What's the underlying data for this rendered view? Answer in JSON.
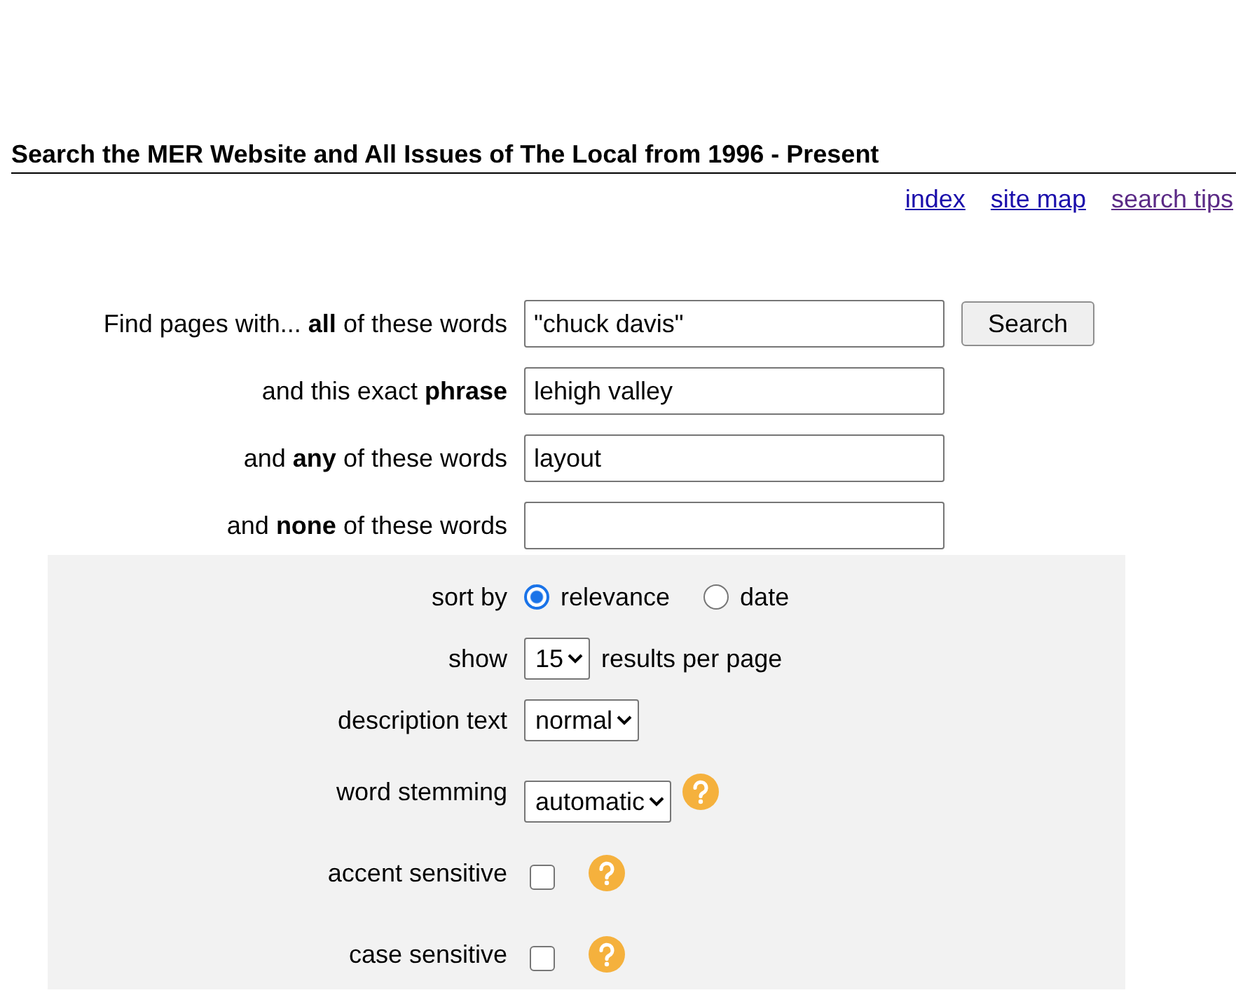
{
  "header": {
    "title": "Search the MER Website and All Issues of The Local from 1996 - Present",
    "links": [
      {
        "label": "index",
        "visited": false
      },
      {
        "label": "site map",
        "visited": false
      },
      {
        "label": "search tips",
        "visited": true
      }
    ]
  },
  "query_fields": [
    {
      "label": "Find pages with... **all** of these words",
      "value": "\"chuck davis\""
    },
    {
      "label": "and this exact **phrase**",
      "value": "lehigh valley"
    },
    {
      "label": "and **any** of these words",
      "value": "layout"
    },
    {
      "label": "and **none** of these words"
    }
  ],
  "search_button": "Search",
  "options": [
    {
      "kind": "radio",
      "label": "sort by",
      "help": false,
      "choices": [
        {
          "label": "relevance",
          "selected": true
        },
        {
          "label": "date",
          "selected": false
        }
      ]
    },
    {
      "kind": "select",
      "label": "show",
      "help": false,
      "value": "15",
      "suffix": "results per page"
    },
    {
      "kind": "select",
      "label": "description text",
      "help": false,
      "value": "normal"
    },
    {
      "kind": "select",
      "label": "word stemming",
      "help": true,
      "value": "automatic"
    },
    {
      "kind": "checkbox",
      "label": "accent sensitive",
      "help": true,
      "checked": false
    },
    {
      "kind": "checkbox",
      "label": "case sensitive",
      "help": true,
      "checked": false
    }
  ]
}
